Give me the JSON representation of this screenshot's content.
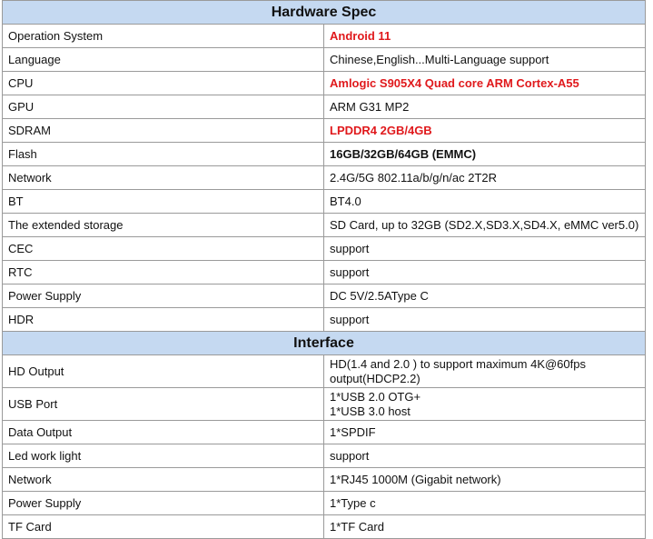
{
  "hardware": {
    "title": "Hardware Spec",
    "rows": [
      {
        "label": "Operation System",
        "value": "Android 11"
      },
      {
        "label": "Language",
        "value": "Chinese,English...Multi-Language support"
      },
      {
        "label": "CPU",
        "value": "Amlogic S905X4 Quad core ARM Cortex-A55"
      },
      {
        "label": "GPU",
        "value": "ARM G31 MP2"
      },
      {
        "label": "SDRAM",
        "value": "LPDDR4 2GB/4GB"
      },
      {
        "label": "Flash",
        "value": "16GB/32GB/64GB (EMMC)"
      },
      {
        "label": "Network",
        "value": "2.4G/5G 802.11a/b/g/n/ac 2T2R"
      },
      {
        "label": "BT",
        "value": "BT4.0"
      },
      {
        "label": "The extended storage",
        "value": "SD Card, up to 32GB (SD2.X,SD3.X,SD4.X, eMMC ver5.0)"
      },
      {
        "label": "CEC",
        "value": "support"
      },
      {
        "label": "RTC",
        "value": "support"
      },
      {
        "label": "Power Supply",
        "value": "DC 5V/2.5AType C"
      },
      {
        "label": "HDR",
        "value": "support"
      }
    ]
  },
  "interface": {
    "title": "Interface",
    "rows": [
      {
        "label": "HD Output",
        "value_line1": "HD(1.4 and 2.0 ) to support maximum 4K@60fps",
        "value_line2": "output(HDCP2.2)"
      },
      {
        "label": "USB Port",
        "value_line1": "1*USB 2.0 OTG+",
        "value_line2": "1*USB 3.0 host"
      },
      {
        "label": "Data Output",
        "value": "1*SPDIF"
      },
      {
        "label": "Led work light",
        "value": "support"
      },
      {
        "label": "Network",
        "value": "1*RJ45 1000M (Gigabit network)"
      },
      {
        "label": "Power Supply",
        "value": "1*Type c"
      },
      {
        "label": "TF Card",
        "value": "1*TF Card"
      }
    ]
  },
  "colors": {
    "section_header_bg": "#c5d9f1",
    "highlight_red": "#e0191c",
    "border": "#9a9a9a"
  }
}
